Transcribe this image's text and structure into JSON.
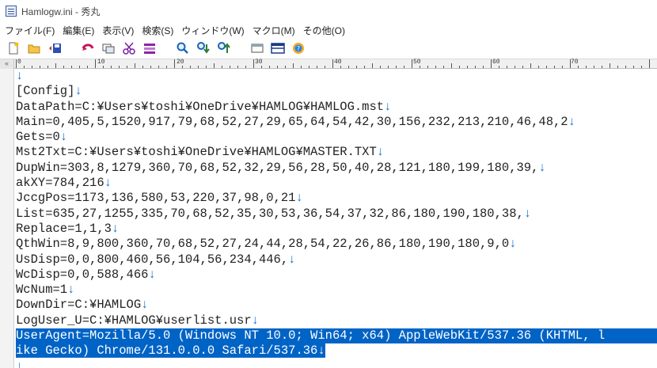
{
  "window": {
    "title": "Hamlogw.ini  - 秀丸"
  },
  "menu": {
    "items": [
      "ファイル(F)",
      "編集(E)",
      "表示(V)",
      "検索(S)",
      "ウィンドウ(W)",
      "マクロ(M)",
      "その他(O)"
    ]
  },
  "ruler": {
    "gutter_mark": "«",
    "labels": [
      "0",
      "10",
      "20",
      "30",
      "40",
      "50",
      "60",
      "70"
    ]
  },
  "editor": {
    "newline_mark": "↓",
    "lines": [
      "",
      "[Config]",
      "DataPath=C:¥Users¥toshi¥OneDrive¥HAMLOG¥HAMLOG.mst",
      "Main=0,405,5,1520,917,79,68,52,27,29,65,64,54,42,30,156,232,213,210,46,48,2",
      "Gets=0",
      "Mst2Txt=C:¥Users¥toshi¥OneDrive¥HAMLOG¥MASTER.TXT",
      "DupWin=303,8,1279,360,70,68,52,32,29,56,28,50,40,28,121,180,199,180,39,",
      "akXY=784,216",
      "JccgPos=1173,136,580,53,220,37,98,0,21",
      "List=635,27,1255,335,70,68,52,35,30,53,36,54,37,32,86,180,190,180,38,",
      "Replace=1,1,3",
      "QthWin=8,9,800,360,70,68,52,27,24,44,28,54,22,26,86,180,190,180,9,0",
      "UsDisp=0,0,800,460,56,104,56,234,446,",
      "WcDisp=0,0,588,466",
      "WcNum=1",
      "DownDir=C:¥HAMLOG",
      "LogUser_U=C:¥HAMLOG¥userlist.usr",
      "UserAgent=Mozilla/5.0 (Windows NT 10.0; Win64; x64) AppleWebKit/537.36 (KHTML, l",
      "ike Gecko) Chrome/131.0.0.0 Safari/537.36",
      ""
    ],
    "wrapped_line_index": 17,
    "selected_lines": [
      17,
      18
    ]
  },
  "colors": {
    "selection": "#0063c6",
    "newline_mark": "#0a6ed1",
    "selected_newline_mark": "#7ff07f"
  }
}
